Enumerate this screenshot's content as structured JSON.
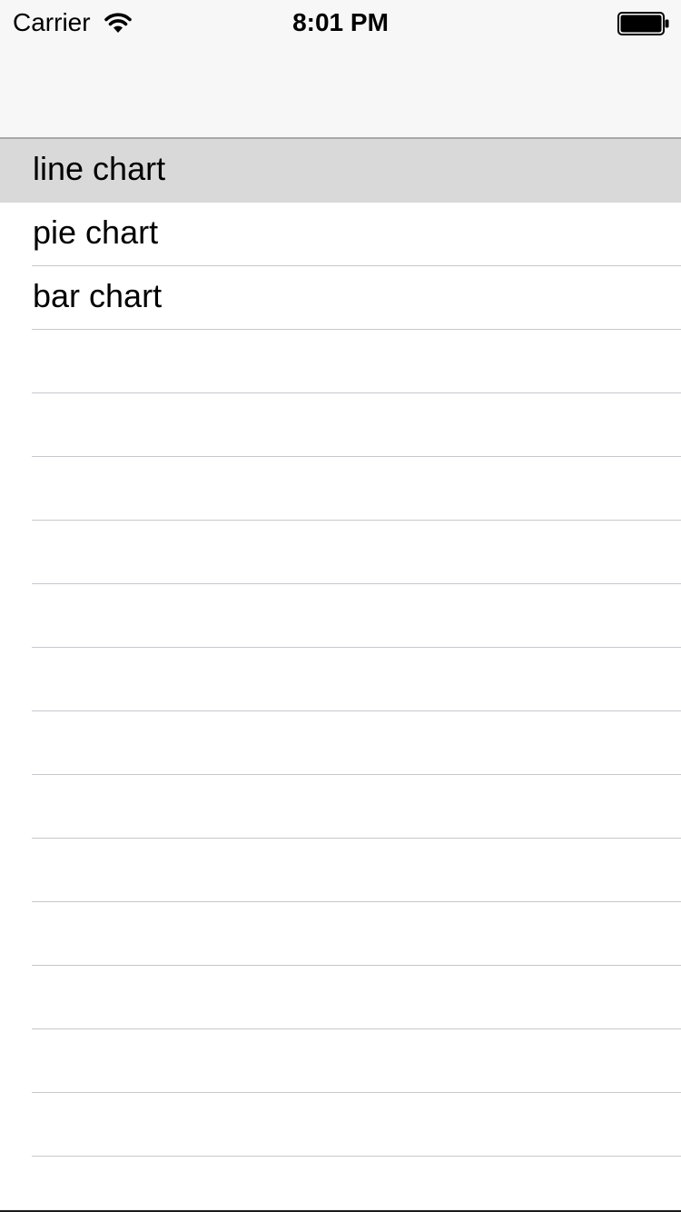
{
  "status_bar": {
    "carrier": "Carrier",
    "time": "8:01 PM",
    "wifi_icon": "wifi-icon",
    "battery_icon": "battery-full-icon"
  },
  "list": {
    "items": [
      {
        "label": "line chart",
        "selected": true
      },
      {
        "label": "pie chart",
        "selected": false
      },
      {
        "label": "bar chart",
        "selected": false
      }
    ]
  },
  "colors": {
    "nav_bg": "#f7f7f7",
    "selected_row": "#d9d9d9",
    "separator": "#c8c7cc",
    "text": "#000000"
  }
}
